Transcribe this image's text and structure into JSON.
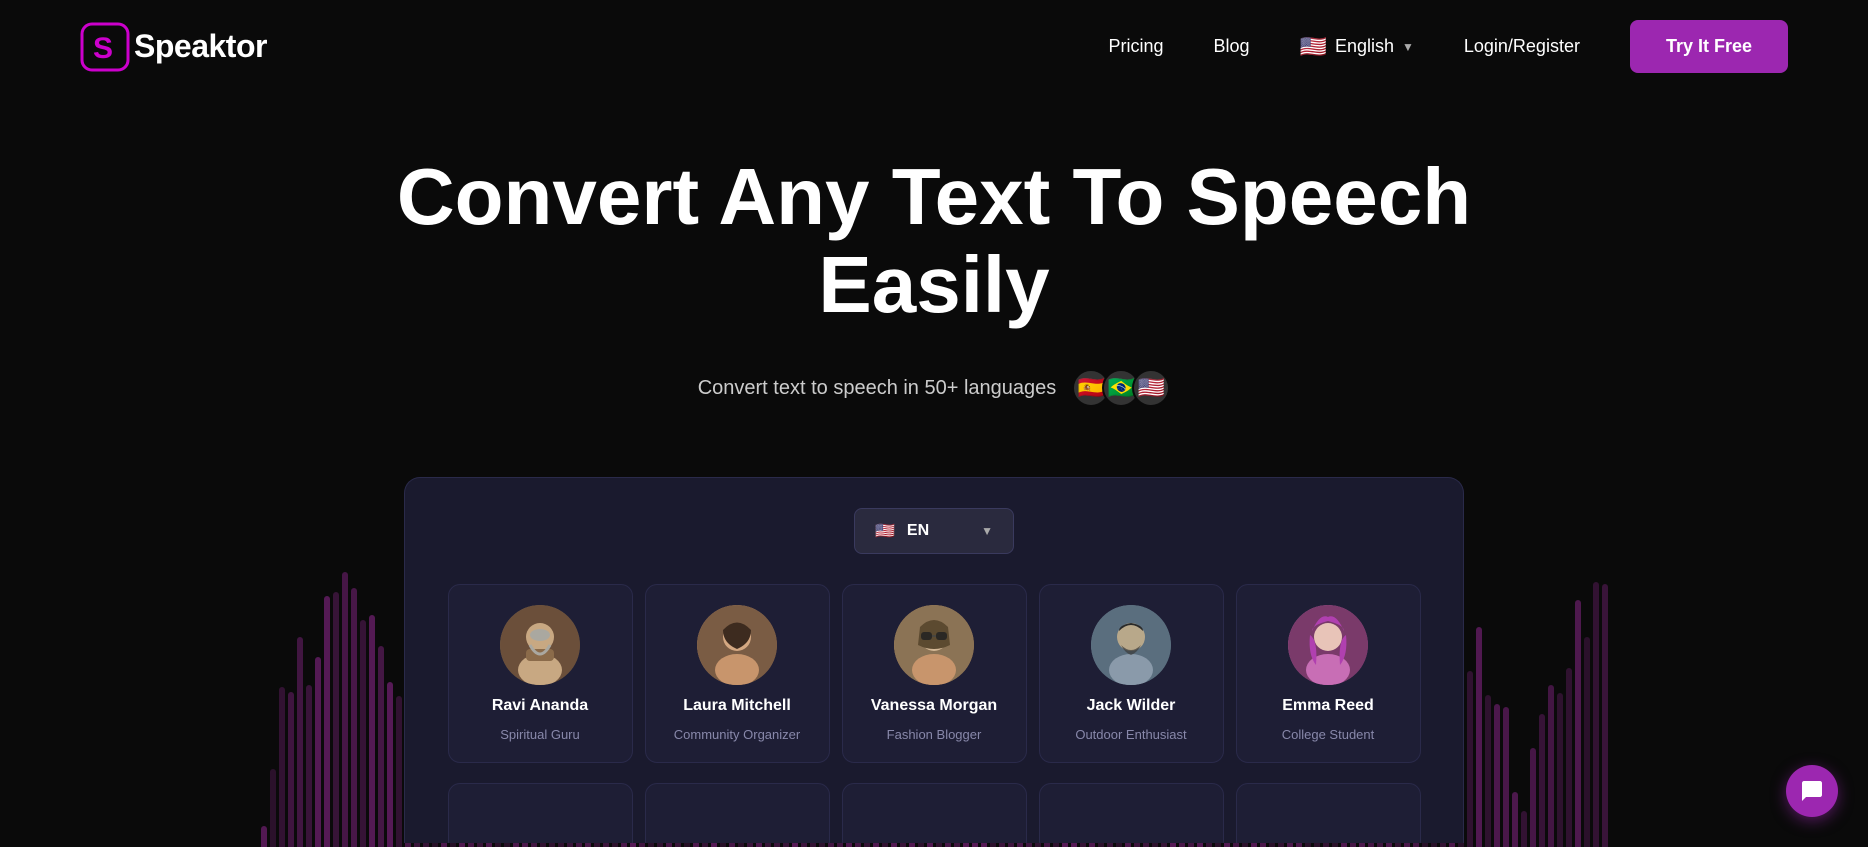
{
  "site": {
    "name": "Speaktor"
  },
  "nav": {
    "pricing_label": "Pricing",
    "blog_label": "Blog",
    "lang_label": "English",
    "login_label": "Login/Register",
    "try_btn_label": "Try It Free"
  },
  "hero": {
    "title": "Convert Any Text To Speech Easily",
    "subtitle": "Convert text to speech in 50+ languages",
    "flags": [
      "🇪🇸",
      "🇧🇷",
      "🇺🇸"
    ]
  },
  "app": {
    "lang_selector": {
      "flag": "🇺🇸",
      "lang": "EN"
    },
    "voices": [
      {
        "id": "ravi",
        "name": "Ravi Ananda",
        "role": "Spiritual Guru",
        "avatar_class": "avatar-ravi",
        "emoji": "🧙"
      },
      {
        "id": "laura",
        "name": "Laura Mitchell",
        "role": "Community Organizer",
        "avatar_class": "avatar-laura",
        "emoji": "👩"
      },
      {
        "id": "vanessa",
        "name": "Vanessa Morgan",
        "role": "Fashion Blogger",
        "avatar_class": "avatar-vanessa",
        "emoji": "👩‍🦳"
      },
      {
        "id": "jack",
        "name": "Jack Wilder",
        "role": "Outdoor Enthusiast",
        "avatar_class": "avatar-jack",
        "emoji": "🧔"
      },
      {
        "id": "emma",
        "name": "Emma Reed",
        "role": "College Student",
        "avatar_class": "avatar-emma",
        "emoji": "👩‍🦱"
      }
    ],
    "partial_cards": 5
  },
  "chat": {
    "icon": "💬"
  }
}
